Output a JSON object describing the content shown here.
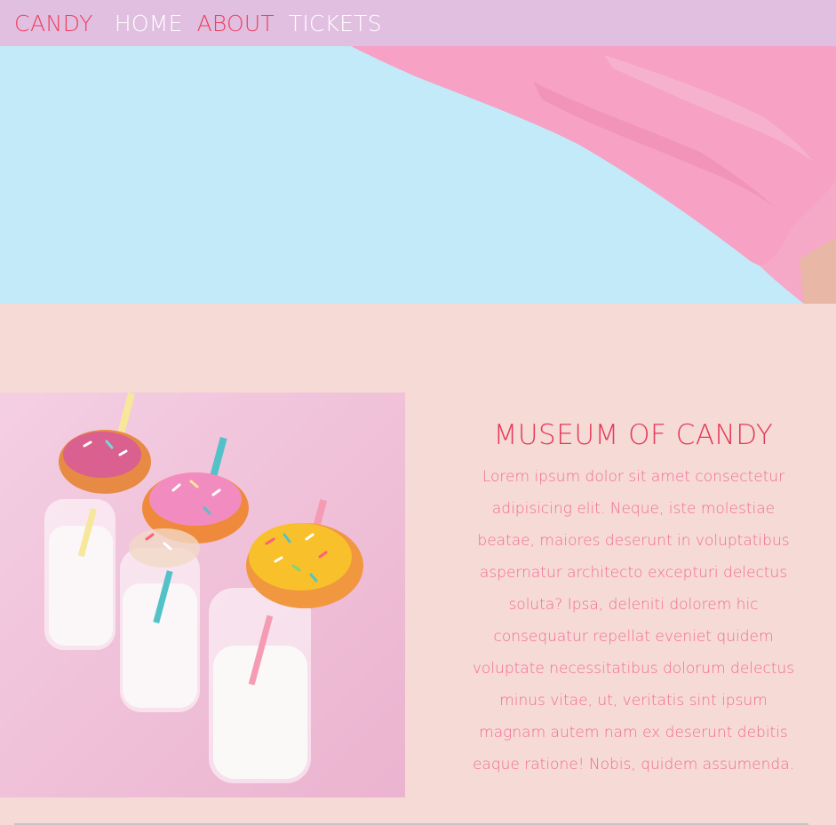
{
  "nav": {
    "brand": "CANDY",
    "links": [
      {
        "label": "HOME",
        "active": false
      },
      {
        "label": "ABOUT",
        "active": true
      },
      {
        "label": "TICKETS",
        "active": false
      }
    ]
  },
  "hero": {
    "image": "pink rubber glove over light blue background"
  },
  "about": {
    "image": "donuts on milk bottles with striped straws",
    "title": "MUSEUM OF CANDY",
    "body": "Lorem ipsum dolor sit amet consectetur adipisicing elit. Neque, iste molestiae beatae, maiores deserunt in voluptatibus aspernatur architecto excepturi delectus soluta? Ipsa, deleniti dolorem hic consequatur repellat eveniet quidem voluptate necessitatibus dolorum delectus minus vitae, ut, veritatis sint ipsum magnam autem nam ex deserunt debitis eaque ratione! Nobis, quidem assumenda."
  },
  "colors": {
    "nav_bg": "#e1bfe0",
    "accent": "#ee3f5f",
    "hero_bg": "#c3eaf8",
    "section_bg": "#f6dad6",
    "body_text": "#f06d92"
  }
}
